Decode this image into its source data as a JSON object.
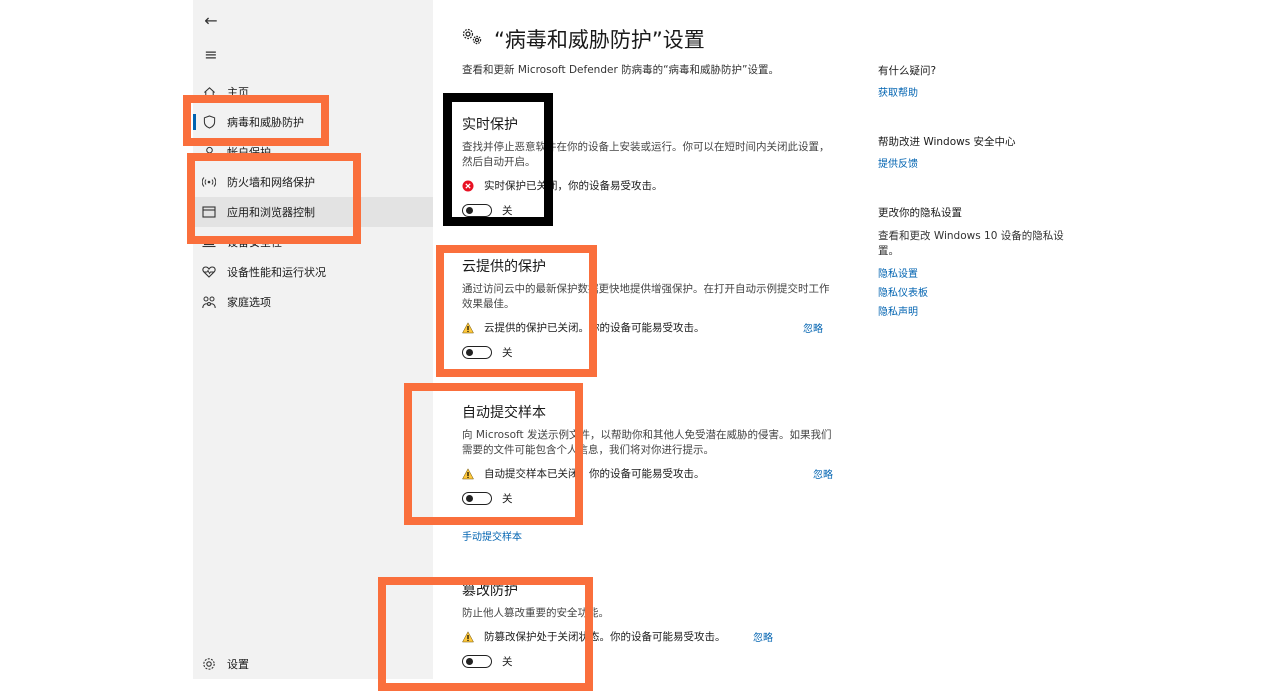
{
  "sidebar": {
    "back_label": "←",
    "menu_label": "≡",
    "items": [
      {
        "label": "主页",
        "icon": "home-icon"
      },
      {
        "label": "病毒和威胁防护",
        "icon": "shield-icon"
      },
      {
        "label": "帐户保护",
        "icon": "person-icon"
      },
      {
        "label": "防火墙和网络保护",
        "icon": "wifi-icon"
      },
      {
        "label": "应用和浏览器控制",
        "icon": "browser-window-icon"
      },
      {
        "label": "设备安全性",
        "icon": "laptop-icon"
      },
      {
        "label": "设备性能和运行状况",
        "icon": "heart-icon"
      },
      {
        "label": "家庭选项",
        "icon": "family-icon"
      }
    ],
    "settings_label": "设置"
  },
  "main": {
    "title": "“病毒和威胁防护”设置",
    "subtitle": "查看和更新 Microsoft Defender 防病毒的“病毒和威胁防护”设置。",
    "realtime": {
      "title": "实时保护",
      "desc": "查找并停止恶意软件在你的设备上安装或运行。你可以在短时间内关闭此设置，然后自动开启。",
      "status": "实时保护已关闭，你的设备易受攻击。",
      "toggle": "关"
    },
    "cloud": {
      "title": "云提供的保护",
      "desc": "通过访问云中的最新保护数据更快地提供增强保护。在打开自动示例提交时工作效果最佳。",
      "status": "云提供的保护已关闭。你的设备可能易受攻击。",
      "ignore": "忽略",
      "toggle": "关"
    },
    "sample": {
      "title": "自动提交样本",
      "desc": "向 Microsoft 发送示例文件，以帮助你和其他人免受潜在威胁的侵害。如果我们需要的文件可能包含个人信息，我们将对你进行提示。",
      "status": "自动提交样本已关闭。你的设备可能易受攻击。",
      "ignore": "忽略",
      "toggle": "关",
      "manual_link": "手动提交样本"
    },
    "tamper": {
      "title": "篡改防护",
      "desc": "防止他人篡改重要的安全功能。",
      "status": "防篡改保护处于关闭状态。你的设备可能易受攻击。",
      "ignore": "忽略",
      "toggle": "关"
    }
  },
  "right": {
    "question_head": "有什么疑问?",
    "get_help": "获取帮助",
    "improve_head": "帮助改进 Windows 安全中心",
    "feedback": "提供反馈",
    "privacy_head": "更改你的隐私设置",
    "privacy_text": "查看和更改 Windows 10 设备的隐私设置。",
    "privacy_links": [
      "隐私设置",
      "隐私仪表板",
      "隐私声明"
    ]
  },
  "colors": {
    "accent": "#0063b1",
    "annotation_orange": "#fa6f3c",
    "annotation_black": "#000000",
    "error_red": "#e81123",
    "warning_yellow": "#ffc83d"
  }
}
